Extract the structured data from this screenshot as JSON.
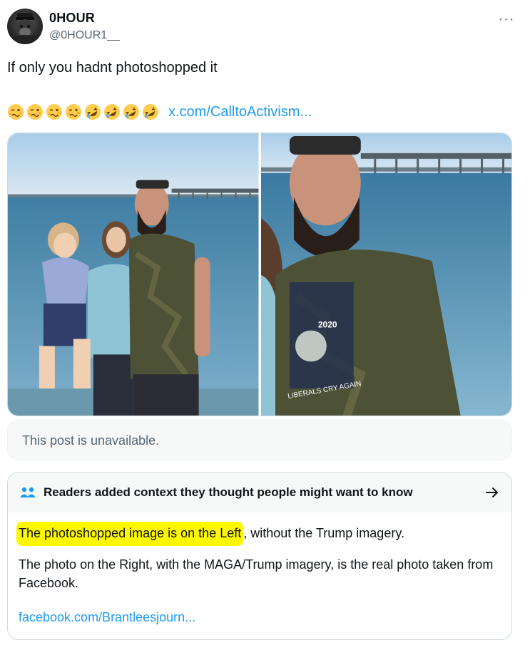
{
  "author": {
    "name": "0HOUR",
    "handle": "@0HOUR1__",
    "avatar_icon": "gorilla-avatar-icon"
  },
  "more_icon": "more-dots-icon",
  "tweet": {
    "text": "If only you hadnt photoshopped it",
    "emojis": [
      "woozy-face",
      "woozy-face",
      "woozy-face",
      "woozy-face",
      "rofl",
      "rofl",
      "rofl",
      "rofl"
    ],
    "link": "x.com/CalltoActivism..."
  },
  "media": {
    "left_photo": "family-on-beach-photo",
    "right_photo": "bearded-man-trump-shirt-photo",
    "shirt_text_year": "2020",
    "shirt_text_bottom": "LIBERALS CRY AGAIN"
  },
  "quote": {
    "unavailable_text": "This post is unavailable."
  },
  "community_note": {
    "header": "Readers added context they thought people might want to know",
    "highlighted": "The photoshopped image is on the Left",
    "rest": ", without the Trump imagery.",
    "paragraph2": "The photo on the Right, with the MAGA/Trump imagery, is the real photo taken from Facebook.",
    "link": "facebook.com/Brantleesjourn...",
    "highlight_color": "#fdf700"
  },
  "colors": {
    "link": "#1d9bf0",
    "secondary_text": "#536471",
    "border": "#cfd9de"
  }
}
